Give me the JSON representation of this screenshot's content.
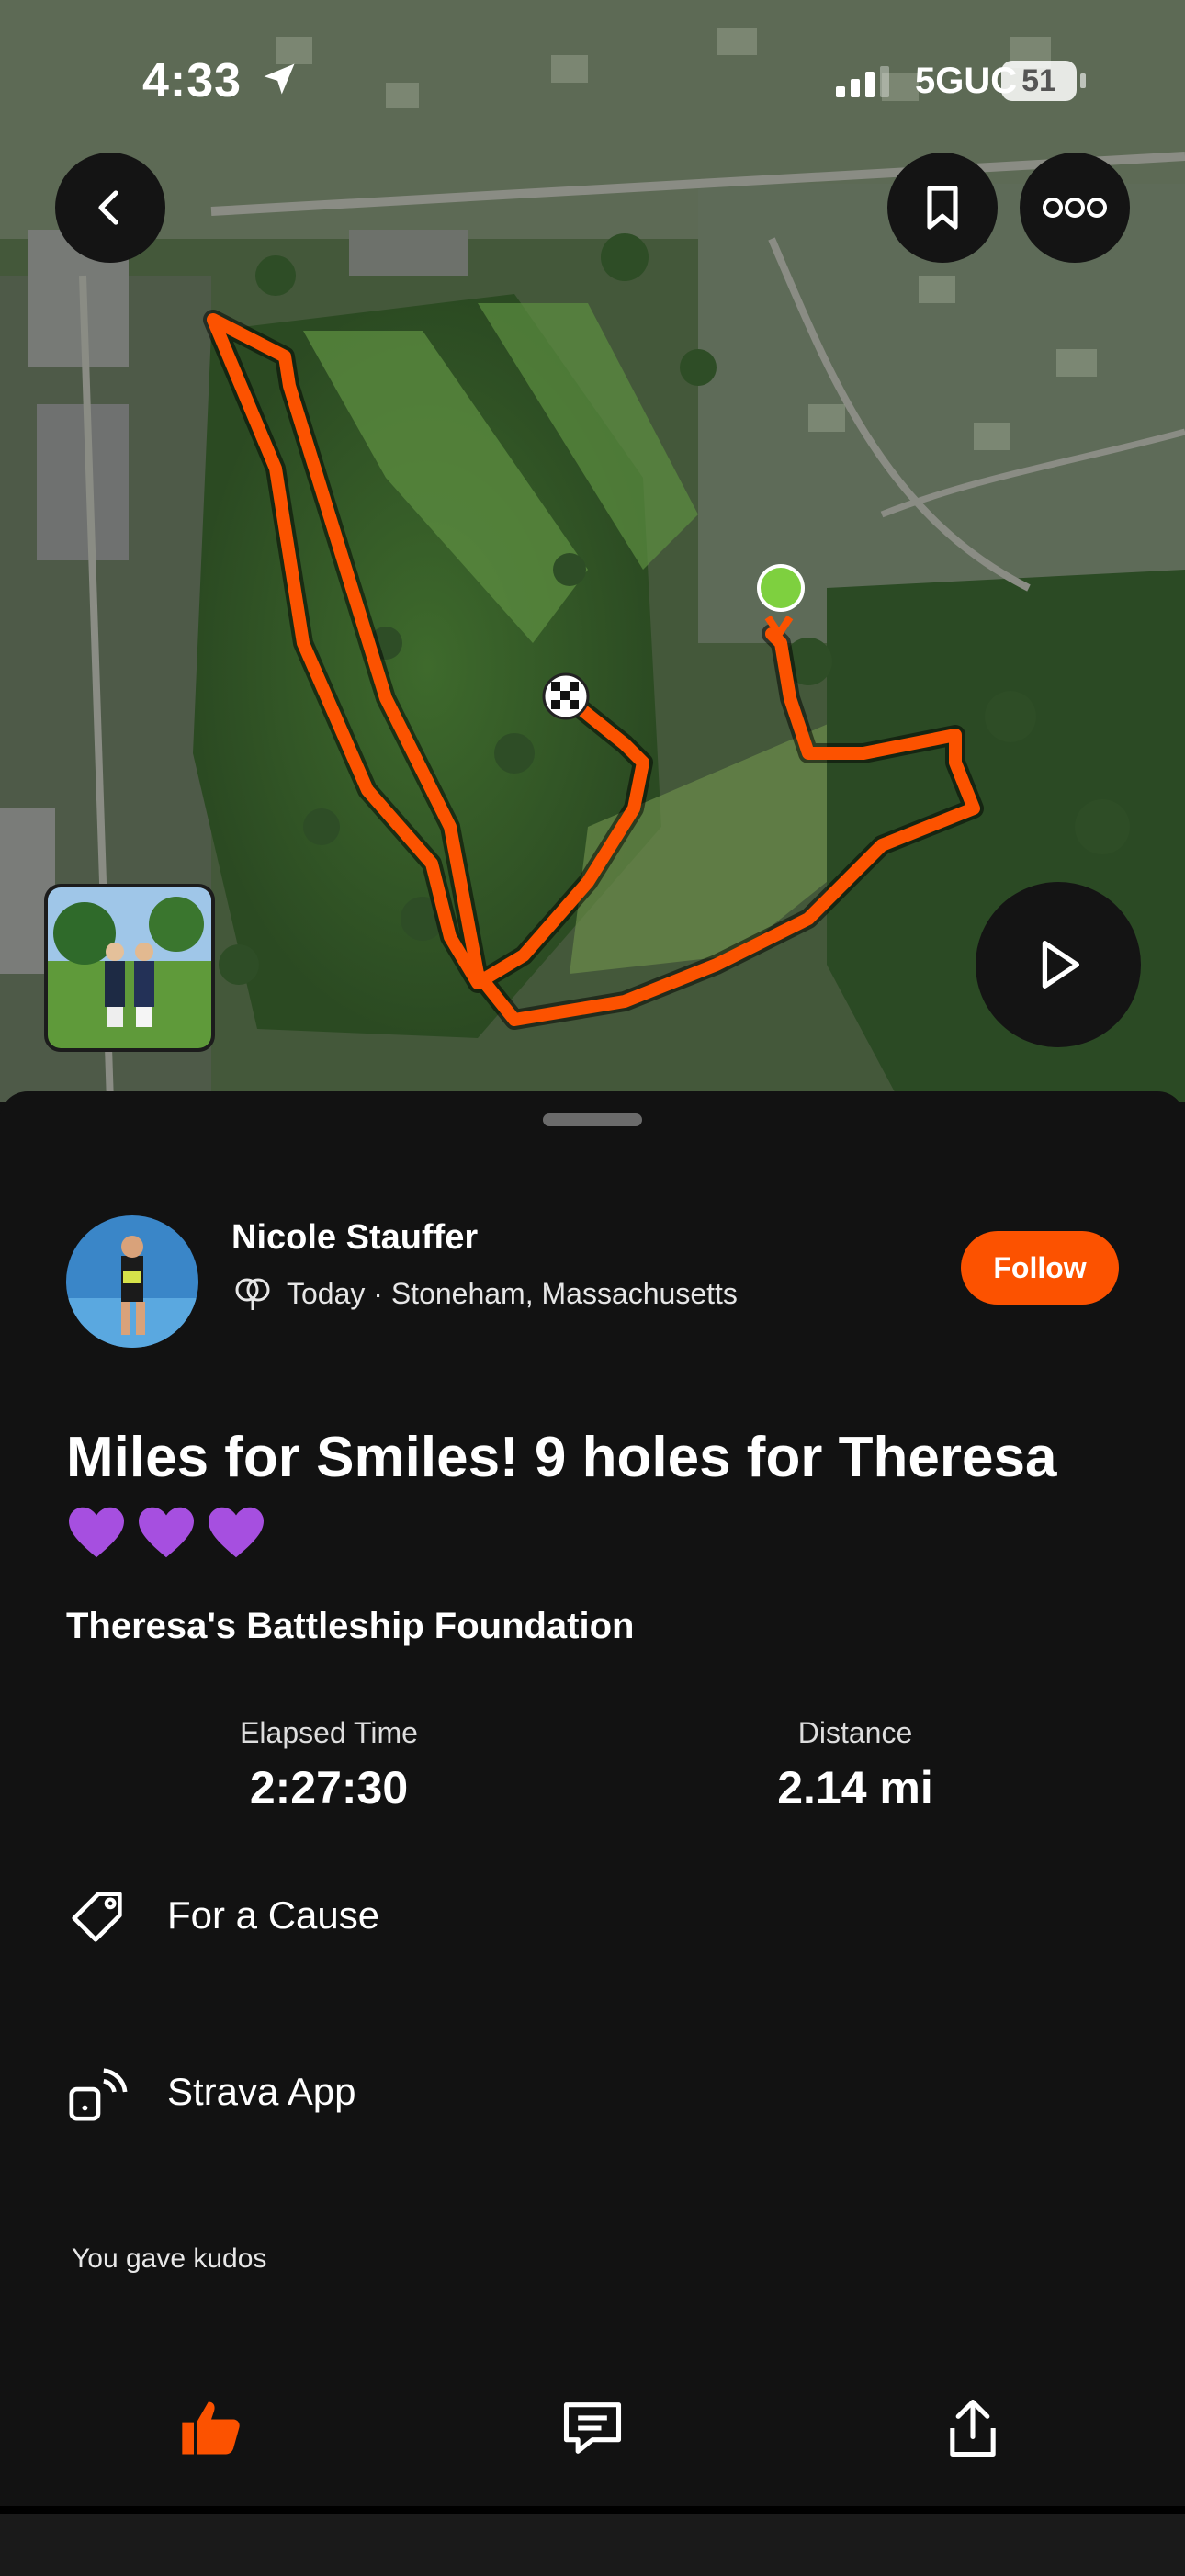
{
  "status_bar": {
    "time": "4:33",
    "network": "5GUC",
    "battery": "51"
  },
  "map": {
    "route_color": "#fc5200",
    "start_color": "#7ed03f"
  },
  "activity": {
    "athlete_name": "Nicole Stauffer",
    "meta": "Today · Stoneham, Massachusetts",
    "follow_label": "Follow",
    "title": "Miles for Smiles! 9 holes for Theresa",
    "title_emoji": "purple-heart-icon x3",
    "club": "Theresa's Battleship Foundation"
  },
  "stats": [
    {
      "label": "Elapsed Time",
      "value": "2:27:30"
    },
    {
      "label": "Distance",
      "value": "2.14 mi"
    }
  ],
  "tags": [
    {
      "icon": "tag-icon",
      "label": "For a Cause"
    },
    {
      "icon": "device-signal-icon",
      "label": "Strava App"
    }
  ],
  "kudos": {
    "text": "You gave kudos"
  },
  "colors": {
    "accent": "#fc5200",
    "background": "#121212"
  }
}
